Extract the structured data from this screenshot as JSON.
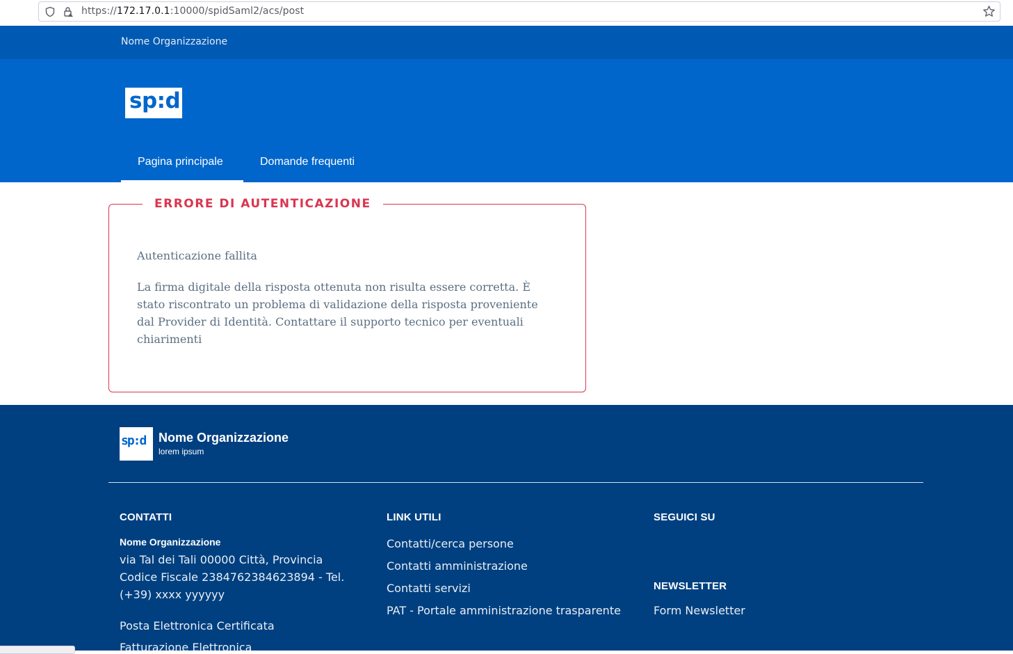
{
  "browser": {
    "url_prefix": "https://",
    "url_host": "172.17.0.1",
    "url_rest": ":10000/spidSaml2/acs/post"
  },
  "header": {
    "org_slim": "Nome Organizzazione",
    "logo_text": "sp:d",
    "nav": [
      {
        "label": "Pagina principale",
        "active": true
      },
      {
        "label": "Domande frequenti",
        "active": false
      }
    ]
  },
  "error": {
    "legend": "ERRORE DI AUTENTICAZIONE",
    "title": "Autenticazione fallita",
    "message": "La firma digitale della risposta ottenuta non risulta essere corretta. È stato riscontrato un problema di validazione della risposta proveniente dal Provider di Identità. Contattare il supporto tecnico per eventuali chiarimenti"
  },
  "footer": {
    "logo_text": "sp:d",
    "org_name": "Nome Organizzazione",
    "org_sub": "lorem ipsum",
    "contacts": {
      "heading": "CONTATTI",
      "name": "Nome Organizzazione",
      "address": "via Tal dei Tali 00000 Città, Provincia Codice Fiscale 2384762384623894 - Tel. (+39) xxxx yyyyyy",
      "links": [
        "Posta Elettronica Certificata",
        "Fatturazione Elettronica"
      ]
    },
    "links": {
      "heading": "LINK UTILI",
      "items": [
        "Contatti/cerca persone",
        "Contatti amministrazione",
        "Contatti servizi",
        "PAT - Portale amministrazione trasparente"
      ]
    },
    "social": {
      "heading": "SEGUICI SU"
    },
    "newsletter": {
      "heading": "NEWSLETTER",
      "link": "Form Newsletter"
    }
  },
  "colors": {
    "slim_header": "#0059b3",
    "header": "#0066cc",
    "footer": "#004080",
    "error": "#d9364f",
    "text_muted": "#5c6f82"
  }
}
